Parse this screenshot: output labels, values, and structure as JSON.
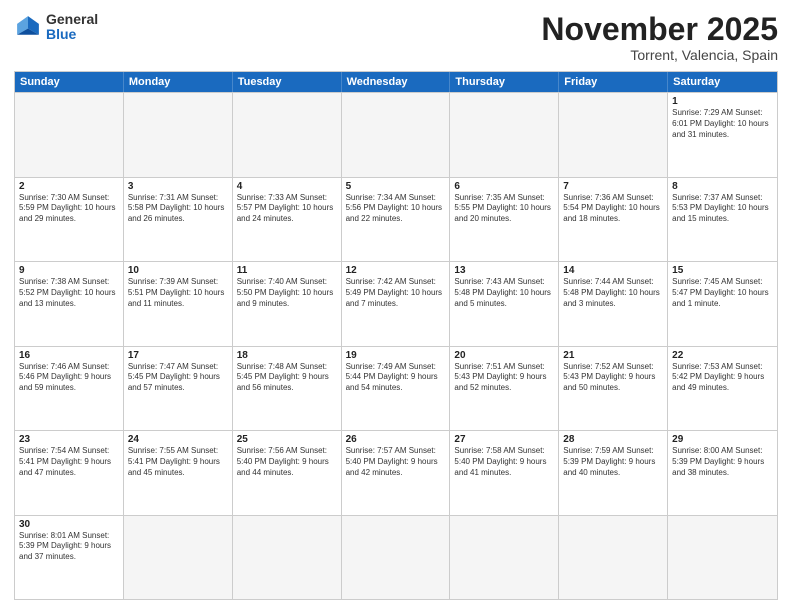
{
  "header": {
    "logo_general": "General",
    "logo_blue": "Blue",
    "month_title": "November 2025",
    "subtitle": "Torrent, Valencia, Spain"
  },
  "calendar": {
    "days_of_week": [
      "Sunday",
      "Monday",
      "Tuesday",
      "Wednesday",
      "Thursday",
      "Friday",
      "Saturday"
    ],
    "weeks": [
      [
        {
          "day": "",
          "empty": true
        },
        {
          "day": "",
          "empty": true
        },
        {
          "day": "",
          "empty": true
        },
        {
          "day": "",
          "empty": true
        },
        {
          "day": "",
          "empty": true
        },
        {
          "day": "",
          "empty": true
        },
        {
          "day": "1",
          "info": "Sunrise: 7:29 AM\nSunset: 6:01 PM\nDaylight: 10 hours\nand 31 minutes."
        }
      ],
      [
        {
          "day": "2",
          "info": "Sunrise: 7:30 AM\nSunset: 5:59 PM\nDaylight: 10 hours\nand 29 minutes."
        },
        {
          "day": "3",
          "info": "Sunrise: 7:31 AM\nSunset: 5:58 PM\nDaylight: 10 hours\nand 26 minutes."
        },
        {
          "day": "4",
          "info": "Sunrise: 7:33 AM\nSunset: 5:57 PM\nDaylight: 10 hours\nand 24 minutes."
        },
        {
          "day": "5",
          "info": "Sunrise: 7:34 AM\nSunset: 5:56 PM\nDaylight: 10 hours\nand 22 minutes."
        },
        {
          "day": "6",
          "info": "Sunrise: 7:35 AM\nSunset: 5:55 PM\nDaylight: 10 hours\nand 20 minutes."
        },
        {
          "day": "7",
          "info": "Sunrise: 7:36 AM\nSunset: 5:54 PM\nDaylight: 10 hours\nand 18 minutes."
        },
        {
          "day": "8",
          "info": "Sunrise: 7:37 AM\nSunset: 5:53 PM\nDaylight: 10 hours\nand 15 minutes."
        }
      ],
      [
        {
          "day": "9",
          "info": "Sunrise: 7:38 AM\nSunset: 5:52 PM\nDaylight: 10 hours\nand 13 minutes."
        },
        {
          "day": "10",
          "info": "Sunrise: 7:39 AM\nSunset: 5:51 PM\nDaylight: 10 hours\nand 11 minutes."
        },
        {
          "day": "11",
          "info": "Sunrise: 7:40 AM\nSunset: 5:50 PM\nDaylight: 10 hours\nand 9 minutes."
        },
        {
          "day": "12",
          "info": "Sunrise: 7:42 AM\nSunset: 5:49 PM\nDaylight: 10 hours\nand 7 minutes."
        },
        {
          "day": "13",
          "info": "Sunrise: 7:43 AM\nSunset: 5:48 PM\nDaylight: 10 hours\nand 5 minutes."
        },
        {
          "day": "14",
          "info": "Sunrise: 7:44 AM\nSunset: 5:48 PM\nDaylight: 10 hours\nand 3 minutes."
        },
        {
          "day": "15",
          "info": "Sunrise: 7:45 AM\nSunset: 5:47 PM\nDaylight: 10 hours\nand 1 minute."
        }
      ],
      [
        {
          "day": "16",
          "info": "Sunrise: 7:46 AM\nSunset: 5:46 PM\nDaylight: 9 hours\nand 59 minutes."
        },
        {
          "day": "17",
          "info": "Sunrise: 7:47 AM\nSunset: 5:45 PM\nDaylight: 9 hours\nand 57 minutes."
        },
        {
          "day": "18",
          "info": "Sunrise: 7:48 AM\nSunset: 5:45 PM\nDaylight: 9 hours\nand 56 minutes."
        },
        {
          "day": "19",
          "info": "Sunrise: 7:49 AM\nSunset: 5:44 PM\nDaylight: 9 hours\nand 54 minutes."
        },
        {
          "day": "20",
          "info": "Sunrise: 7:51 AM\nSunset: 5:43 PM\nDaylight: 9 hours\nand 52 minutes."
        },
        {
          "day": "21",
          "info": "Sunrise: 7:52 AM\nSunset: 5:43 PM\nDaylight: 9 hours\nand 50 minutes."
        },
        {
          "day": "22",
          "info": "Sunrise: 7:53 AM\nSunset: 5:42 PM\nDaylight: 9 hours\nand 49 minutes."
        }
      ],
      [
        {
          "day": "23",
          "info": "Sunrise: 7:54 AM\nSunset: 5:41 PM\nDaylight: 9 hours\nand 47 minutes."
        },
        {
          "day": "24",
          "info": "Sunrise: 7:55 AM\nSunset: 5:41 PM\nDaylight: 9 hours\nand 45 minutes."
        },
        {
          "day": "25",
          "info": "Sunrise: 7:56 AM\nSunset: 5:40 PM\nDaylight: 9 hours\nand 44 minutes."
        },
        {
          "day": "26",
          "info": "Sunrise: 7:57 AM\nSunset: 5:40 PM\nDaylight: 9 hours\nand 42 minutes."
        },
        {
          "day": "27",
          "info": "Sunrise: 7:58 AM\nSunset: 5:40 PM\nDaylight: 9 hours\nand 41 minutes."
        },
        {
          "day": "28",
          "info": "Sunrise: 7:59 AM\nSunset: 5:39 PM\nDaylight: 9 hours\nand 40 minutes."
        },
        {
          "day": "29",
          "info": "Sunrise: 8:00 AM\nSunset: 5:39 PM\nDaylight: 9 hours\nand 38 minutes."
        }
      ],
      [
        {
          "day": "30",
          "info": "Sunrise: 8:01 AM\nSunset: 5:39 PM\nDaylight: 9 hours\nand 37 minutes."
        },
        {
          "day": "",
          "empty": true
        },
        {
          "day": "",
          "empty": true
        },
        {
          "day": "",
          "empty": true
        },
        {
          "day": "",
          "empty": true
        },
        {
          "day": "",
          "empty": true
        },
        {
          "day": "",
          "empty": true
        }
      ]
    ]
  }
}
